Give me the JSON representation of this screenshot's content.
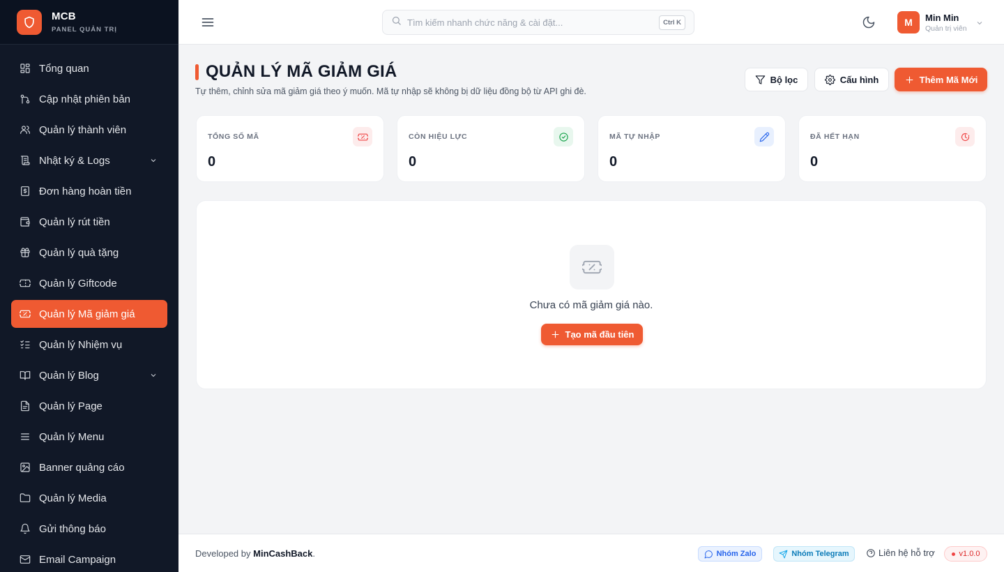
{
  "brand": {
    "name": "MCB",
    "subtitle": "PANEL QUẢN TRỊ"
  },
  "sidebar": {
    "items": [
      {
        "label": "Tổng quan",
        "icon": "dashboard-icon"
      },
      {
        "label": "Cập nhật phiên bản",
        "icon": "git-branch-icon"
      },
      {
        "label": "Quản lý thành viên",
        "icon": "users-icon"
      },
      {
        "label": "Nhật ký & Logs",
        "icon": "scroll-icon",
        "expandable": true
      },
      {
        "label": "Đơn hàng hoàn tiền",
        "icon": "receipt-dollar-icon"
      },
      {
        "label": "Quản lý rút tiền",
        "icon": "wallet-icon"
      },
      {
        "label": "Quản lý quà tặng",
        "icon": "gift-icon"
      },
      {
        "label": "Quản lý Giftcode",
        "icon": "ticket-icon"
      },
      {
        "label": "Quản lý Mã giảm giá",
        "icon": "ticket-percent-icon",
        "active": true
      },
      {
        "label": "Quản lý Nhiệm vụ",
        "icon": "list-checks-icon"
      },
      {
        "label": "Quản lý Blog",
        "icon": "book-icon",
        "expandable": true
      },
      {
        "label": "Quản lý Page",
        "icon": "file-icon"
      },
      {
        "label": "Quản lý Menu",
        "icon": "menu-icon"
      },
      {
        "label": "Banner quảng cáo",
        "icon": "image-icon"
      },
      {
        "label": "Quản lý Media",
        "icon": "folder-icon"
      },
      {
        "label": "Gửi thông báo",
        "icon": "bell-icon"
      },
      {
        "label": "Email Campaign",
        "icon": "mail-icon"
      }
    ]
  },
  "header": {
    "search_placeholder": "Tìm kiếm nhanh chức năng & cài đặt...",
    "search_shortcut": "Ctrl K",
    "user_name": "Min Min",
    "user_role": "Quản trị viên",
    "avatar_initial": "M"
  },
  "page": {
    "title": "QUẢN LÝ MÃ GIẢM GIÁ",
    "subtitle": "Tự thêm, chỉnh sửa mã giảm giá theo ý muốn. Mã tự nhập sẽ không bị dữ liệu đồng bộ từ API ghi đè.",
    "filter_label": "Bộ lọc",
    "config_label": "Cấu hình",
    "add_label": "Thêm Mã Mới"
  },
  "stats": [
    {
      "label": "TỔNG SỐ MÃ",
      "value": "0",
      "icon": "ticket-icon",
      "color": "#ef4444",
      "bg": "#fdecec"
    },
    {
      "label": "CÒN HIỆU LỰC",
      "value": "0",
      "icon": "check-circle-icon",
      "color": "#16a34a",
      "bg": "#e8f7ee"
    },
    {
      "label": "MÃ TỰ NHẬP",
      "value": "0",
      "icon": "pencil-icon",
      "color": "#2563eb",
      "bg": "#e8f0fe"
    },
    {
      "label": "ĐÃ HẾT HẠN",
      "value": "0",
      "icon": "clock-alert-icon",
      "color": "#ef4444",
      "bg": "#fdecec"
    }
  ],
  "empty": {
    "message": "Chưa có mã giảm giá nào.",
    "button_label": "Tạo mã đầu tiên"
  },
  "footer": {
    "developed_prefix": "Developed by",
    "developer": "MinCashBack",
    "developed_suffix": ".",
    "zalo_label": "Nhóm Zalo",
    "telegram_label": "Nhóm Telegram",
    "support_label": "Liên hệ hỗ trợ",
    "version": "v1.0.0"
  },
  "colors": {
    "accent": "#ef5a32",
    "sidebar_bg": "#111827"
  }
}
